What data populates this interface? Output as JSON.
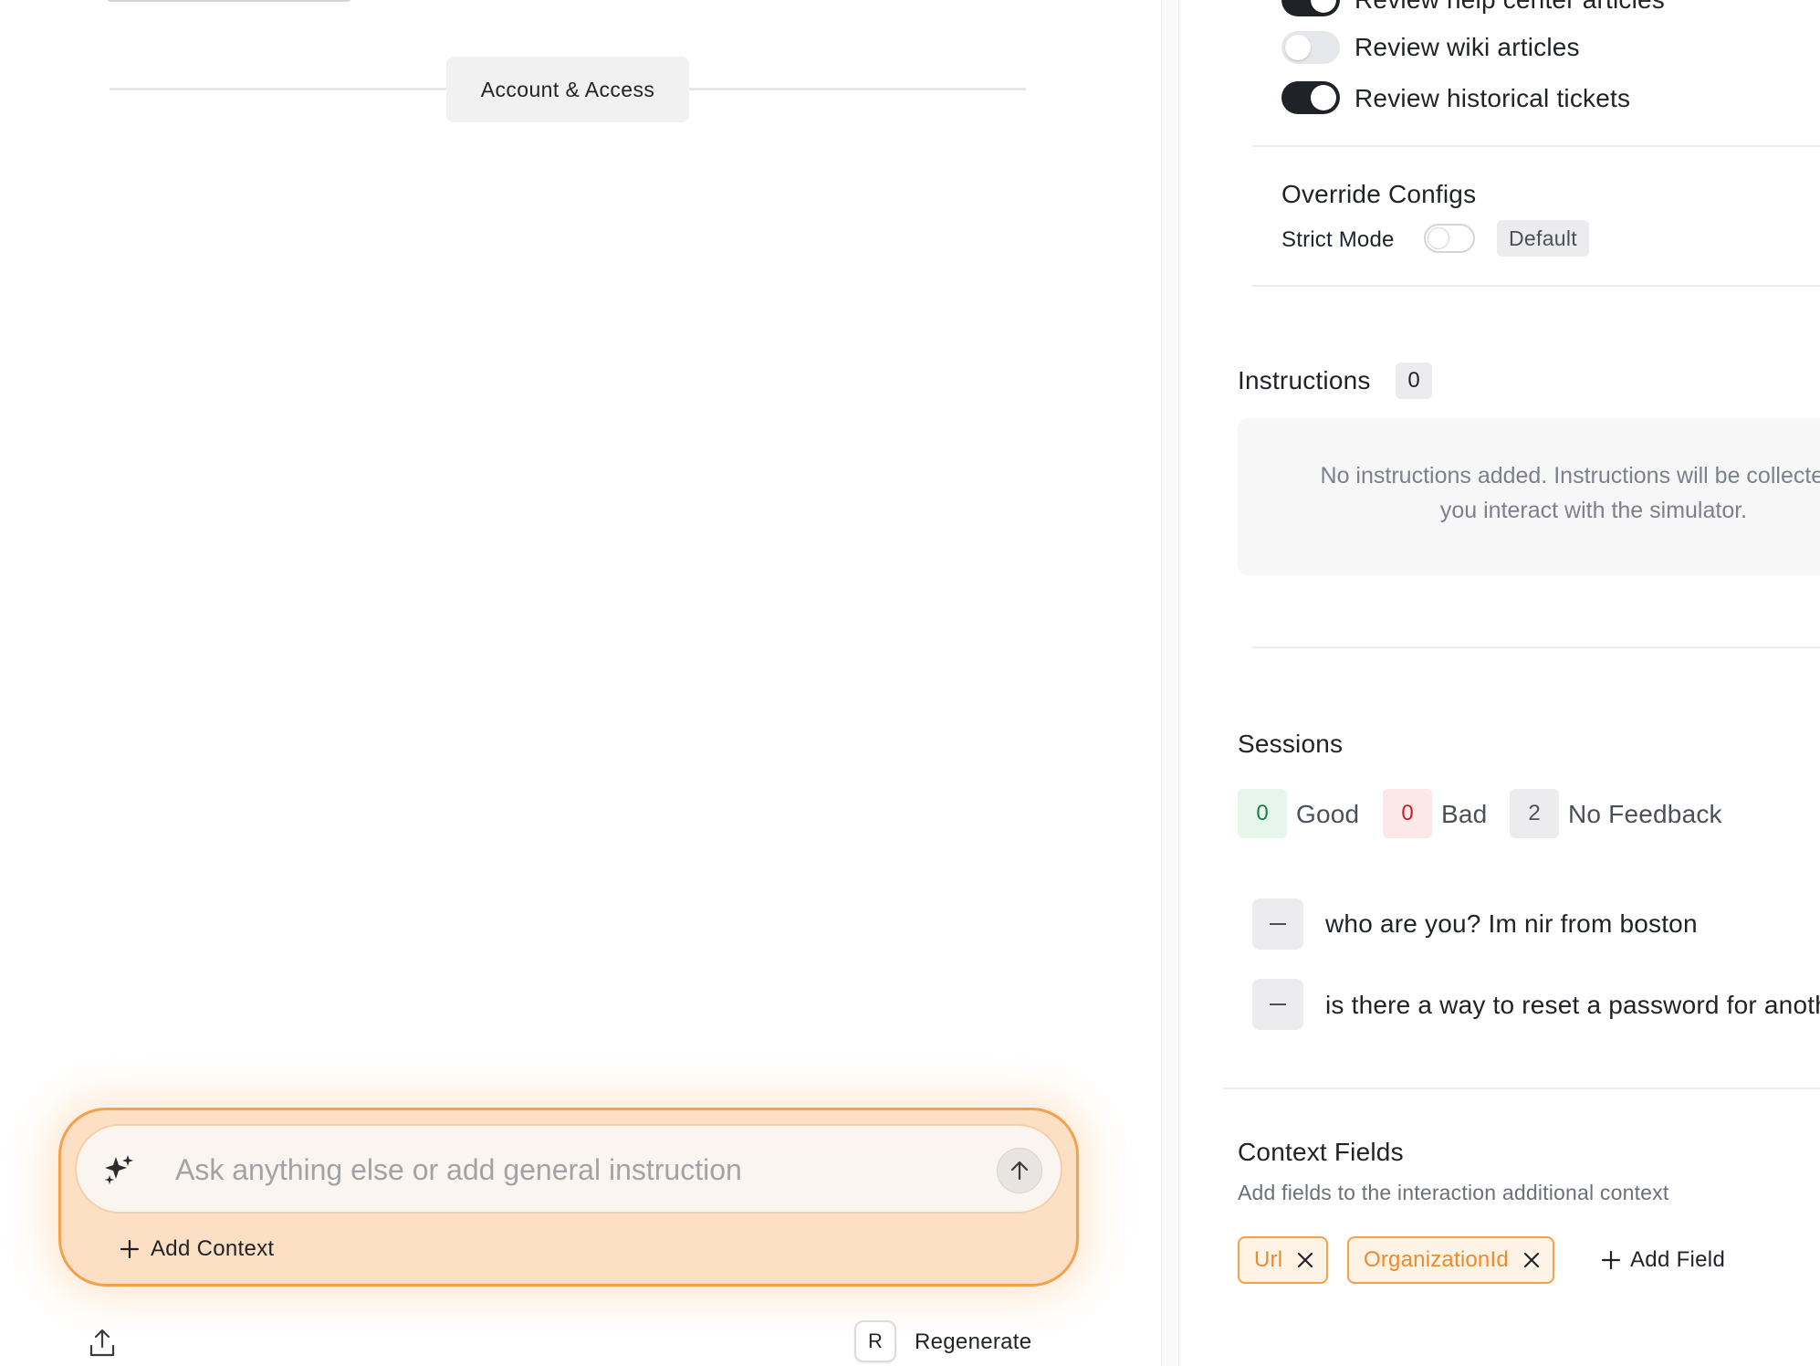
{
  "left": {
    "section_chip": "Account & Access",
    "composer": {
      "placeholder": "Ask anything else or add general instruction",
      "add_context_label": "Add Context"
    },
    "footer": {
      "regenerate_key": "R",
      "regenerate_label": "Regenerate"
    }
  },
  "right": {
    "sources": {
      "items": [
        {
          "label": "Review help center articles",
          "enabled": true
        },
        {
          "label": "Review wiki articles",
          "enabled": false
        },
        {
          "label": "Review historical tickets",
          "enabled": true
        }
      ]
    },
    "override": {
      "title": "Override Configs",
      "strict_mode_label": "Strict Mode",
      "strict_mode_enabled": false,
      "default_badge": "Default"
    },
    "instructions": {
      "title": "Instructions",
      "count": "0",
      "empty_line1": "No instructions added. Instructions will be collected as",
      "empty_line2": "you interact with the simulator."
    },
    "sessions": {
      "title": "Sessions",
      "good_count": "0",
      "good_label": "Good",
      "bad_count": "0",
      "bad_label": "Bad",
      "none_count": "2",
      "none_label": "No Feedback",
      "items": [
        {
          "text": "who are you? Im nir from boston"
        },
        {
          "text": "is there a way to reset a password for another user?"
        }
      ]
    },
    "context_fields": {
      "title": "Context Fields",
      "subtitle": "Add fields to the interaction additional context",
      "fields": [
        {
          "label": "Url"
        },
        {
          "label": "OrganizationId"
        }
      ],
      "add_field_label": "Add Field"
    }
  },
  "colors": {
    "accent_orange": "#f5a04d",
    "toggle_on": "#1f2328",
    "good": "#1a7f46",
    "bad": "#c8202c"
  },
  "icons": {
    "composer": "sparkle-icon",
    "send": "arrow-up-icon",
    "add": "plus-icon",
    "remove": "close-icon",
    "export": "share-upload-icon"
  }
}
